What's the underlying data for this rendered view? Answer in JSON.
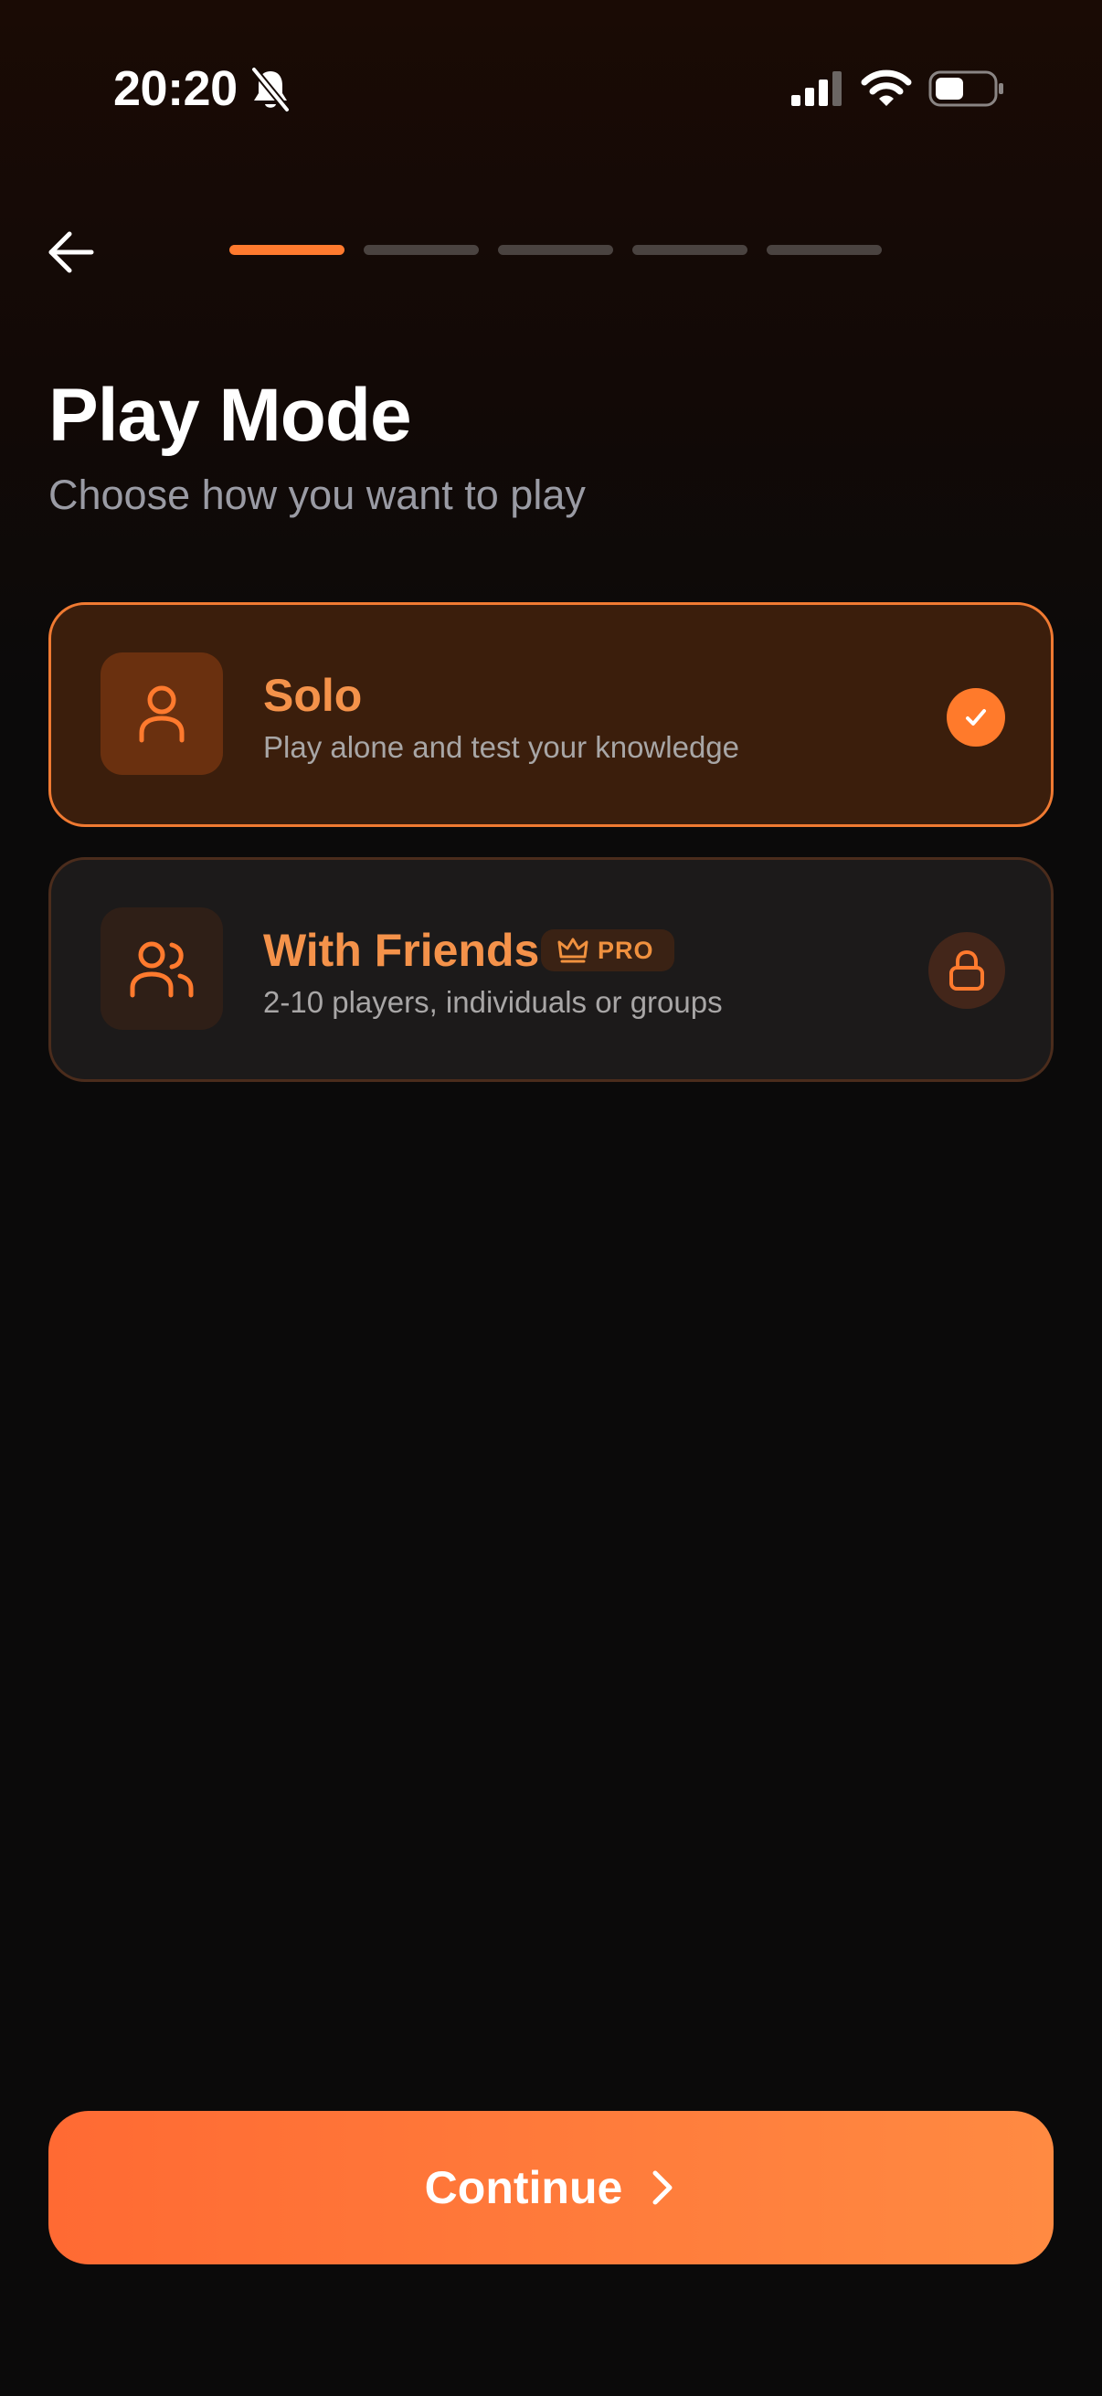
{
  "status_bar": {
    "time": "20:20"
  },
  "header": {
    "back_icon": "arrow-left-icon",
    "progress": {
      "total_steps": 5,
      "current_step": 1
    }
  },
  "page": {
    "title": "Play Mode",
    "subtitle": "Choose how you want to play"
  },
  "modes": [
    {
      "title": "Solo",
      "description": "Play alone and test your knowledge",
      "icon": "user-icon",
      "selected": true,
      "status_icon": "check-icon"
    },
    {
      "title": "With Friends",
      "description": "2-10 players, individuals or groups",
      "icon": "users-icon",
      "badge": "PRO",
      "badge_icon": "crown-icon",
      "locked": true,
      "status_icon": "lock-icon"
    }
  ],
  "continue_button": {
    "label": "Continue",
    "icon": "chevron-right-icon"
  },
  "colors": {
    "accent": "#ff7a2e",
    "background": "#0b0a0a",
    "selected_card": "#3b1e0c",
    "card": "#1c1a1a"
  }
}
